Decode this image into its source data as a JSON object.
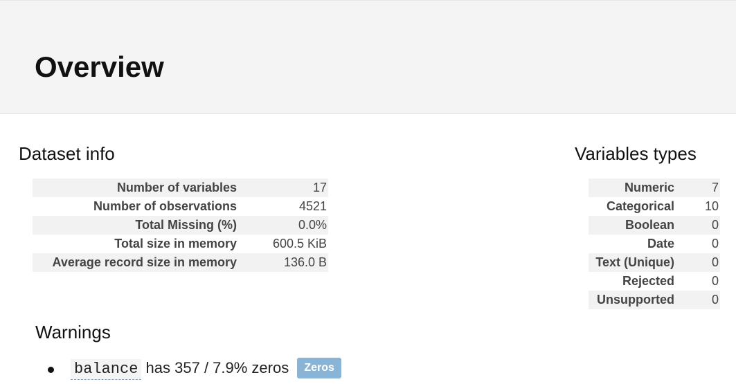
{
  "header": {
    "title": "Overview"
  },
  "dataset_info": {
    "title": "Dataset info",
    "rows": [
      {
        "label": "Number of variables",
        "value": "17"
      },
      {
        "label": "Number of observations",
        "value": "4521"
      },
      {
        "label": "Total Missing (%)",
        "value": "0.0%"
      },
      {
        "label": "Total size in memory",
        "value": "600.5 KiB"
      },
      {
        "label": "Average record size in memory",
        "value": "136.0 B"
      }
    ]
  },
  "variable_types": {
    "title": "Variables types",
    "rows": [
      {
        "label": "Numeric",
        "value": "7"
      },
      {
        "label": "Categorical",
        "value": "10"
      },
      {
        "label": "Boolean",
        "value": "0"
      },
      {
        "label": "Date",
        "value": "0"
      },
      {
        "label": "Text (Unique)",
        "value": "0"
      },
      {
        "label": "Rejected",
        "value": "0"
      },
      {
        "label": "Unsupported",
        "value": "0"
      }
    ]
  },
  "warnings": {
    "title": "Warnings",
    "items": [
      {
        "variable": "balance",
        "text": "has 357 / 7.9% zeros",
        "badge": "Zeros"
      }
    ]
  },
  "colors": {
    "header_bg": "#f4f4f4",
    "row_stripe": "#f2f2f2",
    "badge_bg": "#8ab4d6"
  }
}
